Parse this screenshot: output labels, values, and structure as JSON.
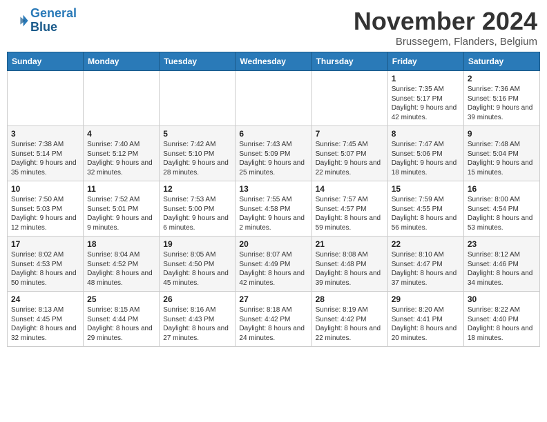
{
  "header": {
    "logo_line1": "General",
    "logo_line2": "Blue",
    "month": "November 2024",
    "location": "Brussegem, Flanders, Belgium"
  },
  "weekdays": [
    "Sunday",
    "Monday",
    "Tuesday",
    "Wednesday",
    "Thursday",
    "Friday",
    "Saturday"
  ],
  "weeks": [
    [
      {
        "day": "",
        "info": ""
      },
      {
        "day": "",
        "info": ""
      },
      {
        "day": "",
        "info": ""
      },
      {
        "day": "",
        "info": ""
      },
      {
        "day": "",
        "info": ""
      },
      {
        "day": "1",
        "info": "Sunrise: 7:35 AM\nSunset: 5:17 PM\nDaylight: 9 hours and 42 minutes."
      },
      {
        "day": "2",
        "info": "Sunrise: 7:36 AM\nSunset: 5:16 PM\nDaylight: 9 hours and 39 minutes."
      }
    ],
    [
      {
        "day": "3",
        "info": "Sunrise: 7:38 AM\nSunset: 5:14 PM\nDaylight: 9 hours and 35 minutes."
      },
      {
        "day": "4",
        "info": "Sunrise: 7:40 AM\nSunset: 5:12 PM\nDaylight: 9 hours and 32 minutes."
      },
      {
        "day": "5",
        "info": "Sunrise: 7:42 AM\nSunset: 5:10 PM\nDaylight: 9 hours and 28 minutes."
      },
      {
        "day": "6",
        "info": "Sunrise: 7:43 AM\nSunset: 5:09 PM\nDaylight: 9 hours and 25 minutes."
      },
      {
        "day": "7",
        "info": "Sunrise: 7:45 AM\nSunset: 5:07 PM\nDaylight: 9 hours and 22 minutes."
      },
      {
        "day": "8",
        "info": "Sunrise: 7:47 AM\nSunset: 5:06 PM\nDaylight: 9 hours and 18 minutes."
      },
      {
        "day": "9",
        "info": "Sunrise: 7:48 AM\nSunset: 5:04 PM\nDaylight: 9 hours and 15 minutes."
      }
    ],
    [
      {
        "day": "10",
        "info": "Sunrise: 7:50 AM\nSunset: 5:03 PM\nDaylight: 9 hours and 12 minutes."
      },
      {
        "day": "11",
        "info": "Sunrise: 7:52 AM\nSunset: 5:01 PM\nDaylight: 9 hours and 9 minutes."
      },
      {
        "day": "12",
        "info": "Sunrise: 7:53 AM\nSunset: 5:00 PM\nDaylight: 9 hours and 6 minutes."
      },
      {
        "day": "13",
        "info": "Sunrise: 7:55 AM\nSunset: 4:58 PM\nDaylight: 9 hours and 2 minutes."
      },
      {
        "day": "14",
        "info": "Sunrise: 7:57 AM\nSunset: 4:57 PM\nDaylight: 8 hours and 59 minutes."
      },
      {
        "day": "15",
        "info": "Sunrise: 7:59 AM\nSunset: 4:55 PM\nDaylight: 8 hours and 56 minutes."
      },
      {
        "day": "16",
        "info": "Sunrise: 8:00 AM\nSunset: 4:54 PM\nDaylight: 8 hours and 53 minutes."
      }
    ],
    [
      {
        "day": "17",
        "info": "Sunrise: 8:02 AM\nSunset: 4:53 PM\nDaylight: 8 hours and 50 minutes."
      },
      {
        "day": "18",
        "info": "Sunrise: 8:04 AM\nSunset: 4:52 PM\nDaylight: 8 hours and 48 minutes."
      },
      {
        "day": "19",
        "info": "Sunrise: 8:05 AM\nSunset: 4:50 PM\nDaylight: 8 hours and 45 minutes."
      },
      {
        "day": "20",
        "info": "Sunrise: 8:07 AM\nSunset: 4:49 PM\nDaylight: 8 hours and 42 minutes."
      },
      {
        "day": "21",
        "info": "Sunrise: 8:08 AM\nSunset: 4:48 PM\nDaylight: 8 hours and 39 minutes."
      },
      {
        "day": "22",
        "info": "Sunrise: 8:10 AM\nSunset: 4:47 PM\nDaylight: 8 hours and 37 minutes."
      },
      {
        "day": "23",
        "info": "Sunrise: 8:12 AM\nSunset: 4:46 PM\nDaylight: 8 hours and 34 minutes."
      }
    ],
    [
      {
        "day": "24",
        "info": "Sunrise: 8:13 AM\nSunset: 4:45 PM\nDaylight: 8 hours and 32 minutes."
      },
      {
        "day": "25",
        "info": "Sunrise: 8:15 AM\nSunset: 4:44 PM\nDaylight: 8 hours and 29 minutes."
      },
      {
        "day": "26",
        "info": "Sunrise: 8:16 AM\nSunset: 4:43 PM\nDaylight: 8 hours and 27 minutes."
      },
      {
        "day": "27",
        "info": "Sunrise: 8:18 AM\nSunset: 4:42 PM\nDaylight: 8 hours and 24 minutes."
      },
      {
        "day": "28",
        "info": "Sunrise: 8:19 AM\nSunset: 4:42 PM\nDaylight: 8 hours and 22 minutes."
      },
      {
        "day": "29",
        "info": "Sunrise: 8:20 AM\nSunset: 4:41 PM\nDaylight: 8 hours and 20 minutes."
      },
      {
        "day": "30",
        "info": "Sunrise: 8:22 AM\nSunset: 4:40 PM\nDaylight: 8 hours and 18 minutes."
      }
    ]
  ]
}
